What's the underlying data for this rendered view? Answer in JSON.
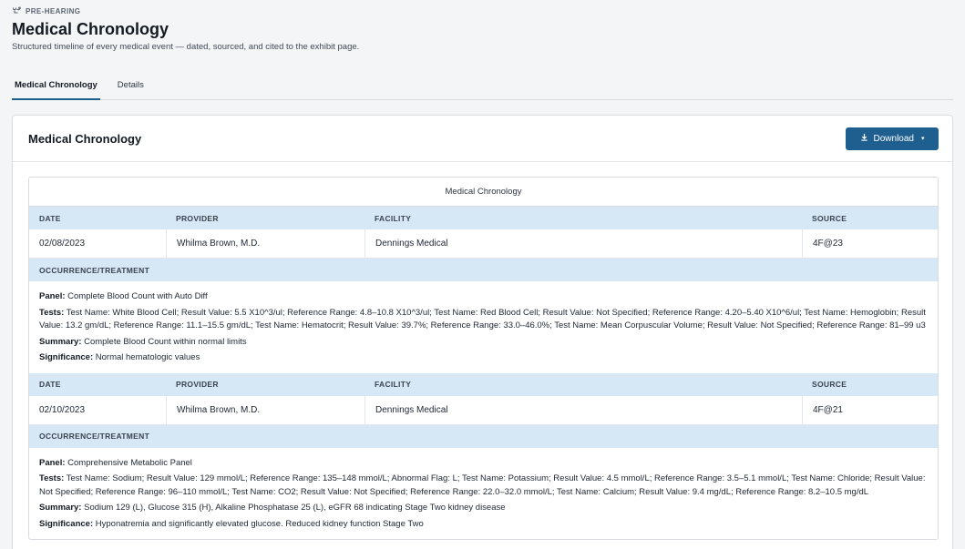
{
  "header": {
    "eyebrow": "PRE-HEARING",
    "title": "Medical Chronology",
    "subtitle": "Structured timeline of every medical event — dated, sourced, and cited to the exhibit page."
  },
  "tabs": [
    {
      "label": "Medical Chronology",
      "active": true
    },
    {
      "label": "Details",
      "active": false
    }
  ],
  "card": {
    "title": "Medical Chronology",
    "download_label": "Download"
  },
  "table": {
    "caption": "Medical Chronology",
    "columns": [
      "DATE",
      "PROVIDER",
      "FACILITY",
      "SOURCE"
    ],
    "occurrence_label": "OCCURRENCE/TREATMENT",
    "entries": [
      {
        "date": "02/08/2023",
        "provider": "Whilma Brown, M.D.",
        "facility": "Dennings Medical",
        "source": "4F@23",
        "panel_label": "Panel:",
        "panel": "Complete Blood Count with Auto Diff",
        "tests_label": "Tests:",
        "tests": "Test Name: White Blood Cell; Result Value: 5.5 X10^3/ul; Reference Range: 4.8–10.8 X10^3/ul; Test Name: Red Blood Cell; Result Value: Not Specified; Reference Range: 4.20–5.40 X10^6/ul; Test Name: Hemoglobin; Result Value: 13.2 gm/dL; Reference Range: 11.1–15.5 gm/dL; Test Name: Hematocrit; Result Value: 39.7%; Reference Range: 33.0–46.0%; Test Name: Mean Corpuscular Volume; Result Value: Not Specified; Reference Range: 81–99 u3",
        "summary_label": "Summary:",
        "summary": "Complete Blood Count within normal limits",
        "significance_label": "Significance:",
        "significance": "Normal hematologic values"
      },
      {
        "date": "02/10/2023",
        "provider": "Whilma Brown, M.D.",
        "facility": "Dennings Medical",
        "source": "4F@21",
        "panel_label": "Panel:",
        "panel": "Comprehensive Metabolic Panel",
        "tests_label": "Tests:",
        "tests": "Test Name: Sodium; Result Value: 129 mmol/L; Reference Range: 135–148 mmol/L; Abnormal Flag: L; Test Name: Potassium; Result Value: 4.5 mmol/L; Reference Range: 3.5–5.1 mmol/L; Test Name: Chloride; Result Value: Not Specified; Reference Range: 96–110 mmol/L; Test Name: CO2; Result Value: Not Specified; Reference Range: 22.0–32.0 mmol/L; Test Name: Calcium; Result Value: 9.4 mg/dL; Reference Range: 8.2–10.5 mg/dL",
        "summary_label": "Summary:",
        "summary": "Sodium 129 (L), Glucose 315 (H), Alkaline Phosphatase 25 (L), eGFR 68 indicating Stage Two kidney disease",
        "significance_label": "Significance:",
        "significance": "Hyponatremia and significantly elevated glucose. Reduced kidney function Stage Two"
      }
    ]
  },
  "icons": {
    "eyebrow": "stethoscope-icon",
    "download": "download-icon",
    "caret": "chevron-down-icon"
  },
  "colors": {
    "accent": "#1f5f8f",
    "table_header_bg": "#d6e7f5"
  }
}
